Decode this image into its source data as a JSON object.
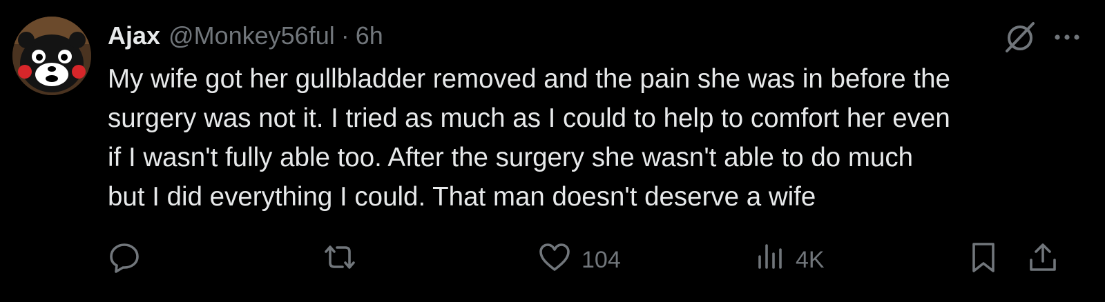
{
  "tweet": {
    "author_name": "Ajax",
    "author_handle": "@Monkey56ful",
    "separator": "·",
    "time": "6h",
    "text": "My wife got her gullbladder removed and the pain she was in before the\nsurgery was not it. I tried as much as I could to help to comfort her even\nif I wasn't fully able too. After the surgery she wasn't able to do much\nbut I did everything I could. That man doesn't deserve a wife",
    "likes": "104",
    "views": "4K"
  },
  "icons": {
    "reply": "reply-icon",
    "repost": "repost-icon",
    "like": "heart-icon",
    "views": "analytics-icon",
    "bookmark": "bookmark-icon",
    "share": "share-icon",
    "grok": "grok-icon",
    "more": "more-icon"
  },
  "colors": {
    "background": "#000000",
    "text": "#e7e9ea",
    "muted": "#71767b"
  }
}
